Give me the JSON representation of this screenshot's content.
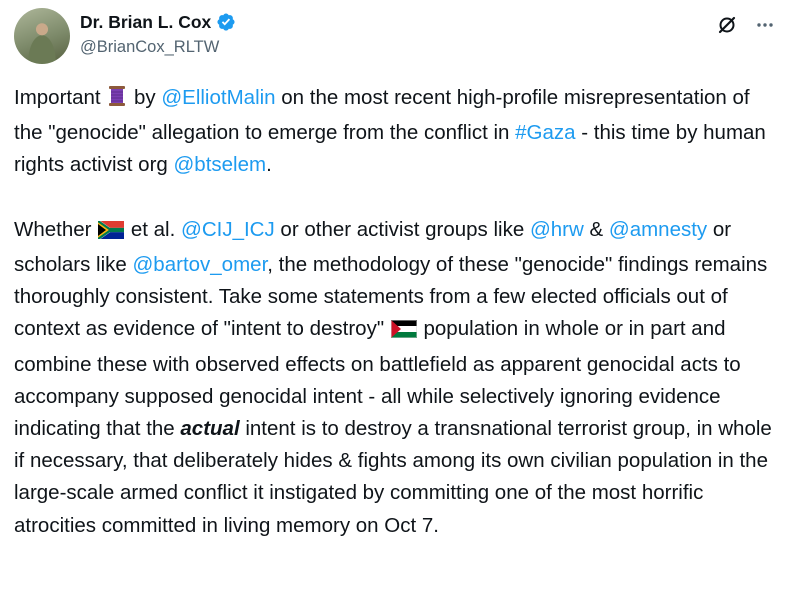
{
  "author": {
    "display_name": "Dr. Brian L. Cox",
    "handle": "@BrianCox_RLTW",
    "verified": true
  },
  "actions": {
    "grok_icon": "grok-icon",
    "more_icon": "more-icon"
  },
  "tweet": {
    "p1": {
      "t1": "Important ",
      "emoji1": "thread-emoji",
      "t2": " by ",
      "mention1": "@ElliotMalin",
      "t3": " on the most recent high-profile misrepresentation of the \"genocide\" allegation to emerge from the conflict in ",
      "hashtag1": "#Gaza",
      "t4": " - this time by human rights activist org ",
      "mention2": "@btselem",
      "t5": "."
    },
    "p2": {
      "t1": "Whether ",
      "emoji1": "south-africa-flag",
      "t2": " et al. ",
      "mention1": "@CIJ_ICJ",
      "t3": " or other activist groups like ",
      "mention2": "@hrw",
      "t4": " & ",
      "mention3": "@amnesty",
      "t5": " or scholars like ",
      "mention4": "@bartov_omer",
      "t6": ", the methodology of these \"genocide\" findings remains thoroughly consistent. Take some statements from a few elected officials out of context as evidence of \"intent to destroy\" ",
      "emoji2": "palestine-flag",
      "t7": " population in whole or in part and combine these with observed effects on battlefield as apparent genocidal acts to accompany supposed genocidal intent - all while selectively ignoring evidence indicating that the ",
      "emphasis": "actual",
      "t8": " intent is to destroy a transnational terrorist group, in whole if necessary, that deliberately hides & fights among its own civilian population in the large-scale armed conflict it instigated by committing one of the most horrific atrocities committed in living memory on Oct 7."
    }
  },
  "colors": {
    "text": "#0f1419",
    "secondary": "#536471",
    "link": "#1d9bf0"
  }
}
